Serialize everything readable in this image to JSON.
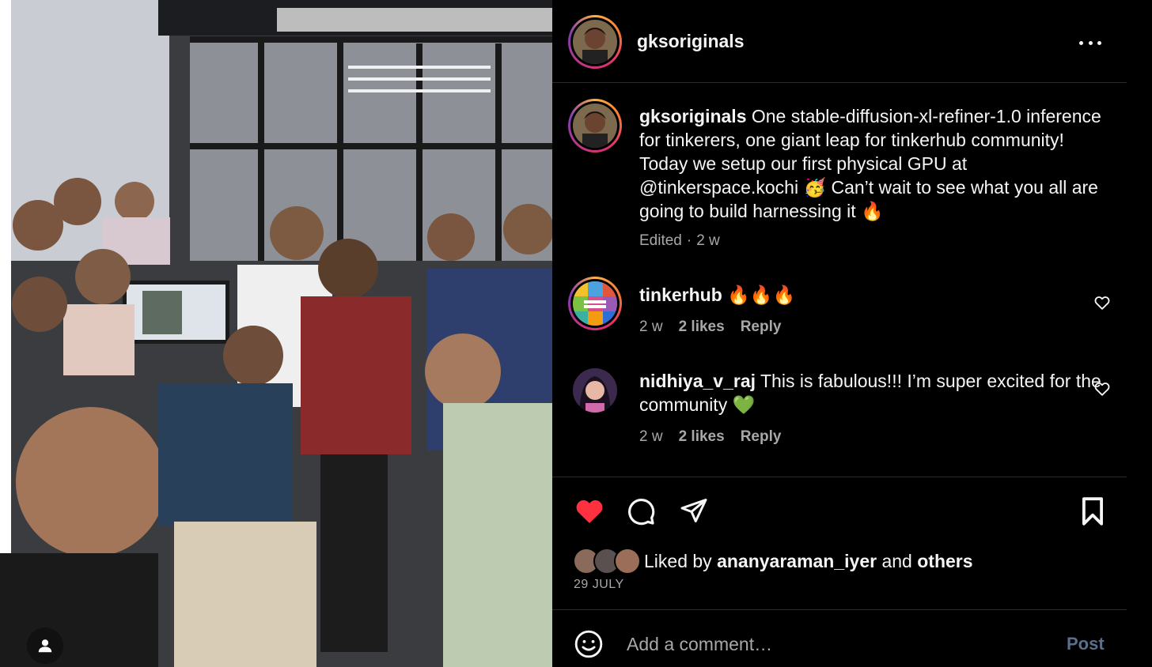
{
  "post": {
    "author": "gksoriginals"
  },
  "caption": {
    "username": "gksoriginals",
    "text": " One stable-diffusion-xl-refiner-1.0 inference for tinkerers, one giant leap for tinkerhub community! Today we setup our first physical GPU at @tinkerspace.kochi 🥳 Can’t wait to see what you all are going to build harnessing it 🔥",
    "edited": "Edited",
    "time": "2 w"
  },
  "comments": [
    {
      "username": "tinkerhub",
      "text": " 🔥🔥🔥",
      "time": "2 w",
      "likes": "2 likes",
      "reply": "Reply"
    },
    {
      "username": "nidhiya_v_raj",
      "text": " This is fabulous!!! I’m super excited for the community 💚",
      "time": "2 w",
      "likes": "2 likes",
      "reply": "Reply"
    }
  ],
  "likes": {
    "prefix": "Liked by ",
    "user": "ananyaraman_iyer",
    "middle": " and ",
    "others": "others"
  },
  "date": "29 JULY",
  "comment_box": {
    "placeholder": "Add a comment…",
    "post_label": "Post"
  },
  "colors": {
    "like_red": "#ff3040",
    "post_disabled": "#5b6f8c",
    "secondary_text": "#a8a8a8"
  },
  "icons": [
    "user-tag-icon",
    "more-icon",
    "heart-outline-icon",
    "heart-filled-icon",
    "comment-icon",
    "share-icon",
    "bookmark-icon",
    "emoji-icon"
  ]
}
